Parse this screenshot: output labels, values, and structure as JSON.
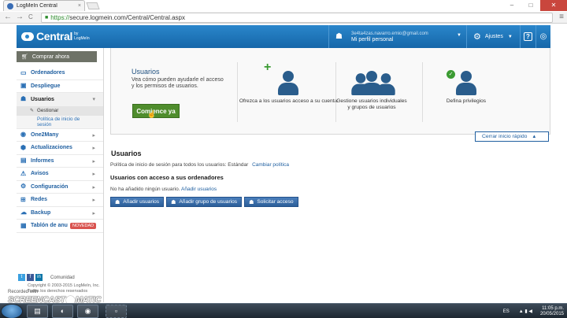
{
  "browser": {
    "tab_title": "LogMeIn Central",
    "tab_close": "×",
    "url_protocol": "https://",
    "url_rest": "secure.logmein.com/Central/Central.aspx",
    "back": "←",
    "forward": "→",
    "reload": "C",
    "menu": "≡",
    "win_min": "–",
    "win_max": "□",
    "win_close": "✕"
  },
  "header": {
    "brand": "Central",
    "brand_by": "by LogMeIn",
    "user_email": "3e4ta4zas.navarro.emio@gmail.com",
    "profile_label": "Mi perfil personal",
    "settings_label": "Ajustes",
    "help_label": "?",
    "globe": "◎"
  },
  "sidebar": {
    "buy_label": "Comprar ahora",
    "items": [
      {
        "label": "Ordenadores",
        "icon": "computer-icon",
        "glyph": "▭"
      },
      {
        "label": "Despliegue",
        "icon": "deploy-icon",
        "glyph": "▣"
      },
      {
        "label": "Usuarios",
        "icon": "users-icon",
        "glyph": "☗"
      },
      {
        "label": "One2Many",
        "icon": "one2many-icon",
        "glyph": "◉"
      },
      {
        "label": "Actualizaciones",
        "icon": "updates-icon",
        "glyph": "⬢"
      },
      {
        "label": "Informes",
        "icon": "reports-icon",
        "glyph": "▤"
      },
      {
        "label": "Avisos",
        "icon": "alerts-icon",
        "glyph": "⚠"
      },
      {
        "label": "Configuración",
        "icon": "config-icon",
        "glyph": "⚙"
      },
      {
        "label": "Redes",
        "icon": "network-icon",
        "glyph": "⊞"
      },
      {
        "label": "Backup",
        "icon": "backup-icon",
        "glyph": "☁"
      },
      {
        "label": "Tablón de anu",
        "icon": "board-icon",
        "glyph": "▦",
        "badge": "NOVEDAD"
      }
    ],
    "sub_manage": "Gestionar",
    "sub_policy": "Política de inicio de sesión",
    "community": "Comunidad",
    "copyright": "Copyright © 2003-2015 LogMeIn, Inc. Todos los derechos reservados"
  },
  "quickstart": {
    "title": "Usuarios",
    "desc": "Vea cómo pueden ayudarle el acceso y los permisos de usuarios.",
    "start_label": "Comience ya",
    "step1": "Ofrezca a los usuarios acceso a su cuenta",
    "step2": "Gestione usuarios individuales y grupos de usuarios",
    "step3": "Defina privilegios",
    "close_label": "Cerrar inicio rápido"
  },
  "main": {
    "title": "Usuarios",
    "policy_text": "Política de inicio de sesión para todos los usuarios: Estándar",
    "policy_link": "Cambiar política",
    "access_heading": "Usuarios con acceso a sus ordenadores",
    "none_text": "No ha añadido ningún usuario.",
    "none_link": "Añadir usuarios",
    "btn_add_users": "Añadir usuarios",
    "btn_add_group": "Añadir grupo de usuarios",
    "btn_request": "Solicitar acceso"
  },
  "watermark": {
    "recorded": "Recorded with",
    "brand_left": "SCREENCAST",
    "brand_right": "MATIC"
  },
  "taskbar": {
    "lang": "ES",
    "time": "11:05 p.m.",
    "date": "20/05/2015"
  },
  "colors": {
    "header_blue": "#1e78be",
    "start_green": "#4f8d2d",
    "link_blue": "#1f5fa0"
  }
}
